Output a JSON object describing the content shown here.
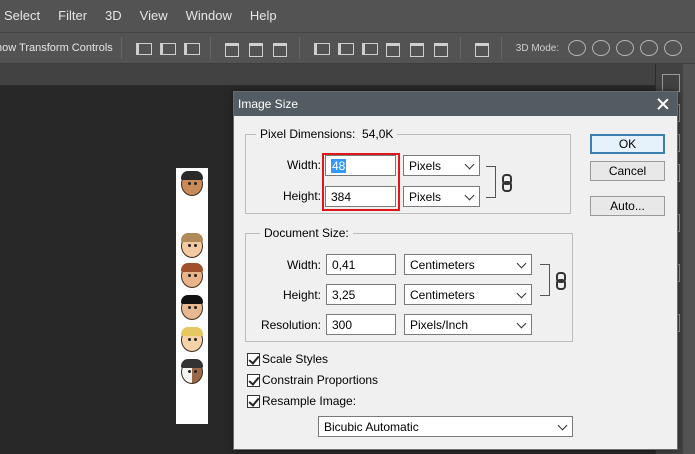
{
  "menu": [
    "Select",
    "Filter",
    "3D",
    "View",
    "Window",
    "Help"
  ],
  "options_bar": {
    "show_transform_label": "how Transform Controls",
    "mode_label": "3D Mode:"
  },
  "dialog": {
    "title": "Image Size",
    "pixel_dimensions": {
      "legend_prefix": "Pixel Dimensions:",
      "size": "54,0K",
      "width_label": "Width:",
      "width_value": "48",
      "width_unit": "Pixels",
      "height_label": "Height:",
      "height_value": "384",
      "height_unit": "Pixels"
    },
    "document_size": {
      "legend": "Document Size:",
      "width_label": "Width:",
      "width_value": "0,41",
      "width_unit": "Centimeters",
      "height_label": "Height:",
      "height_value": "3,25",
      "height_unit": "Centimeters",
      "resolution_label": "Resolution:",
      "resolution_value": "300",
      "resolution_unit": "Pixels/Inch"
    },
    "checkboxes": {
      "scale_styles": "Scale Styles",
      "constrain_proportions": "Constrain Proportions",
      "resample_image": "Resample Image:"
    },
    "resample_method": "Bicubic Automatic",
    "buttons": {
      "ok": "OK",
      "cancel": "Cancel",
      "auto": "Auto..."
    }
  },
  "colors": {
    "accent_highlight": "#e0161b",
    "title_bar": "#535c62",
    "selection": "#3399ff"
  }
}
